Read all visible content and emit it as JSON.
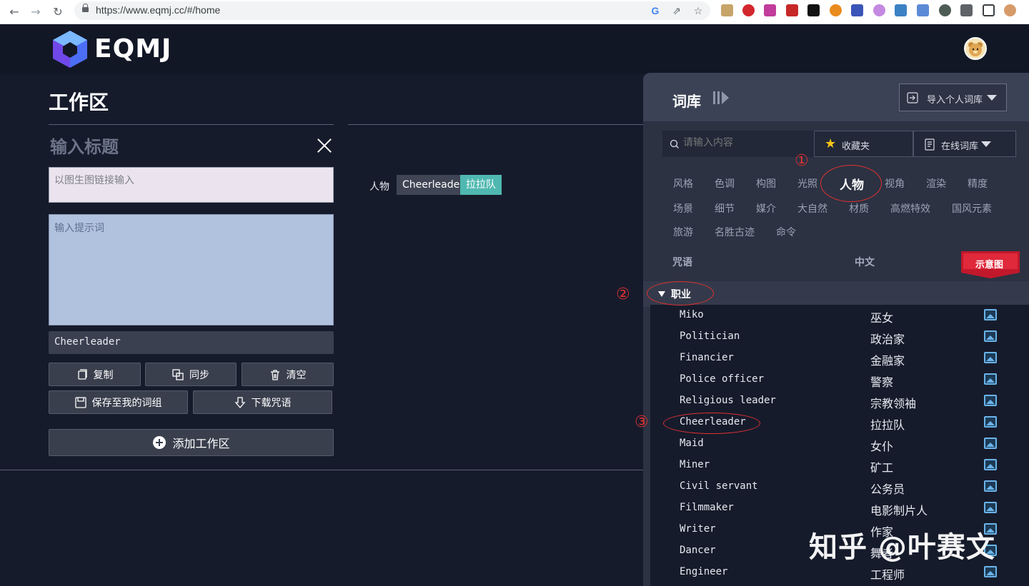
{
  "browser": {
    "url": "https://www.eqmj.cc/#/home"
  },
  "site": {
    "brand": "EQMJ"
  },
  "workspace": {
    "title": "工作区",
    "title_placeholder": "输入标题",
    "image_link_placeholder": "以图生图链接输入",
    "prompt_placeholder": "输入提示词",
    "prompt_output": "Cheerleader",
    "buttons": {
      "copy": "复制",
      "sync": "同步",
      "clear": "清空",
      "save": "保存至我的词组",
      "download": "下载咒语",
      "add_workspace": "添加工作区"
    },
    "tag_row": {
      "label": "人物",
      "en": "Cheerleader",
      "zh": "拉拉队"
    }
  },
  "library": {
    "title": "词库",
    "import_button": "导入个人词库",
    "search_placeholder": "请输入内容",
    "favorites": "收藏夹",
    "online": "在线词库",
    "categories": [
      "风格",
      "色调",
      "构图",
      "光照",
      "人物",
      "视角",
      "渲染",
      "精度",
      "场景",
      "细节",
      "媒介",
      "大自然",
      "材质",
      "高燃特效",
      "国风元素",
      "旅游",
      "名胜古迹",
      "命令"
    ],
    "active_category": "人物",
    "columns": {
      "spell": "咒语",
      "chinese": "中文",
      "sample": "示意图"
    },
    "group": "职业",
    "items": [
      {
        "en": "Miko",
        "zh": "巫女"
      },
      {
        "en": "Politician",
        "zh": "政治家"
      },
      {
        "en": "Financier",
        "zh": "金融家"
      },
      {
        "en": "Police officer",
        "zh": "警察"
      },
      {
        "en": "Religious leader",
        "zh": "宗教领袖"
      },
      {
        "en": "Cheerleader",
        "zh": "拉拉队"
      },
      {
        "en": "Maid",
        "zh": "女仆"
      },
      {
        "en": "Miner",
        "zh": "矿工"
      },
      {
        "en": "Civil servant",
        "zh": "公务员"
      },
      {
        "en": "Filmmaker",
        "zh": "电影制片人"
      },
      {
        "en": "Writer",
        "zh": "作家"
      },
      {
        "en": "Dancer",
        "zh": "舞者"
      },
      {
        "en": "Engineer",
        "zh": "工程师"
      }
    ]
  },
  "annotations": {
    "n1": "①",
    "n2": "②",
    "n3": "③"
  },
  "watermark": "知乎 @叶赛文",
  "colors": {
    "accent_teal": "#4fb8b0",
    "note_red": "#e03131",
    "panel": "#2c3242",
    "page_bg": "#161b2b"
  }
}
